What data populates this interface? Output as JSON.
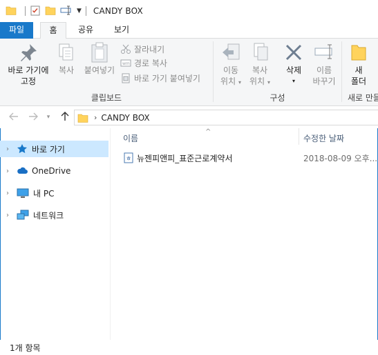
{
  "window": {
    "title": "CANDY BOX"
  },
  "tabs": [
    {
      "label": "파일"
    },
    {
      "label": "홈"
    },
    {
      "label": "공유"
    },
    {
      "label": "보기"
    }
  ],
  "ribbon": {
    "pin": {
      "line1": "바로 가기에",
      "line2": "고정"
    },
    "copy": {
      "label": "복사"
    },
    "paste": {
      "label": "붙여넣기"
    },
    "cut": {
      "label": "잘라내기"
    },
    "copy_path": {
      "label": "경로 복사"
    },
    "paste_shortcut": {
      "label": "바로 가기 붙여넣기"
    },
    "clipboard_group": "클립보드",
    "move_to": {
      "line1": "이동",
      "line2": "위치"
    },
    "copy_to": {
      "line1": "복사",
      "line2": "위치"
    },
    "delete": {
      "label": "삭제"
    },
    "rename": {
      "line1": "이름",
      "line2": "바꾸기"
    },
    "organize_group": "구성",
    "new_folder": {
      "line1": "새",
      "line2": "폴더"
    },
    "new_group": "새로 만들"
  },
  "address": {
    "path": "CANDY BOX"
  },
  "nav": [
    {
      "label": "바로 가기",
      "icon": "star-icon"
    },
    {
      "label": "OneDrive",
      "icon": "cloud-icon"
    },
    {
      "label": "내 PC",
      "icon": "monitor-icon"
    },
    {
      "label": "네트워크",
      "icon": "network-icon"
    }
  ],
  "columns": {
    "name": "이름",
    "modified": "수정한 날짜"
  },
  "files": [
    {
      "name": "뉴젠피앤피_표준근로계약서",
      "modified": "2018-08-09 오후..."
    }
  ],
  "status": {
    "count": "1개 항목"
  },
  "colors": {
    "accent": "#1979ca",
    "selected": "#cce8ff",
    "ribbon_bg": "#f5f6f7"
  }
}
